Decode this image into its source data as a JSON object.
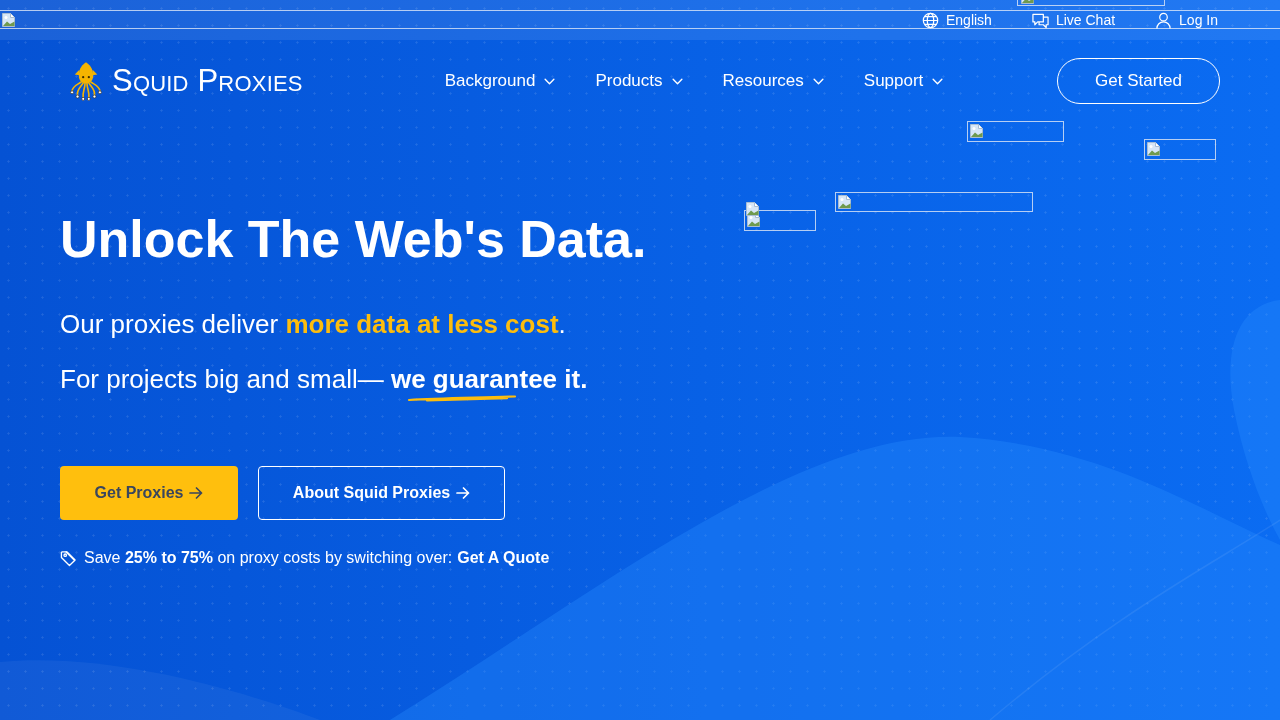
{
  "top_bar": {
    "links": [
      {
        "label": "English"
      },
      {
        "label": "Live Chat"
      },
      {
        "label": "Log In"
      }
    ]
  },
  "header": {
    "logo_text": "Squid Proxies",
    "nav": [
      {
        "label": "Background"
      },
      {
        "label": "Products"
      },
      {
        "label": "Resources"
      },
      {
        "label": "Support"
      }
    ],
    "cta": "Get Started"
  },
  "hero": {
    "title": "Unlock The Web's Data.",
    "lines": [
      {
        "kind": "accent",
        "text": "Our proxies deliver **more data at less cost**."
      },
      {
        "kind": "underlined",
        "text": "For projects big and small— **we guarantee it.**"
      }
    ],
    "buttons": [
      {
        "kind": "primary",
        "label": "Get Proxies"
      },
      {
        "kind": "outline",
        "label": "About Squid Proxies"
      }
    ],
    "note": "Save **25% to 75%** on proxy costs by switching over:",
    "note_link": "Get A Quote"
  }
}
